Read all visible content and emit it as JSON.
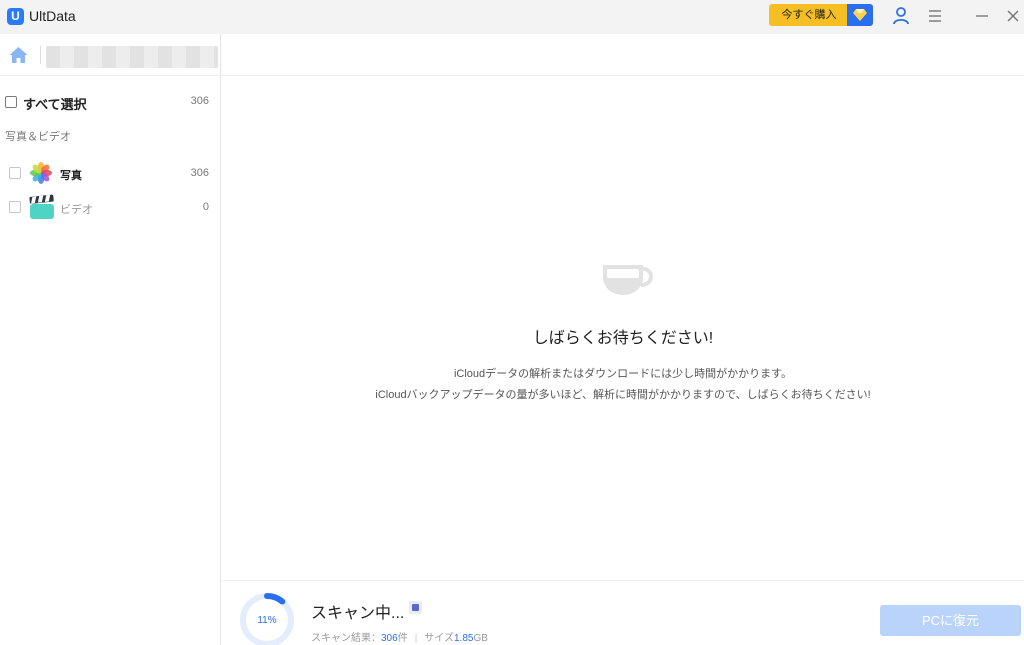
{
  "app": {
    "title": "UltData",
    "logo_letter": "U"
  },
  "titlebar": {
    "buy_label": "今すぐ購入",
    "buy_color": "#f5bf24",
    "accent_color": "#2a6ff0",
    "icons": [
      "user-icon",
      "menu-icon",
      "minimize-icon",
      "close-icon",
      "diamond-icon"
    ]
  },
  "sidebar": {
    "select_all": {
      "label": "すべて選択",
      "count": "306"
    },
    "group_label": "写真＆ビデオ",
    "items": [
      {
        "label": "写真",
        "count": "306",
        "icon": "photos-app-icon"
      },
      {
        "label": "ビデオ",
        "count": "0",
        "icon": "video-clapper-icon"
      }
    ]
  },
  "main": {
    "wait_title": "しばらくお待ちください!",
    "wait_line1": "iCloudデータの解析またはダウンロードには少し時間がかかります。",
    "wait_line2": "iCloudバックアップデータの量が多いほど、解析に時間がかかりますので、しばらくお待ちください!"
  },
  "scan": {
    "progress_label": "11%",
    "progress_value": 0.11,
    "title": "スキャン中...",
    "result_prefix": "スキャン結果：",
    "result_count": "306",
    "result_unit": "件",
    "size_prefix": "サイズ",
    "size_value": "1.85",
    "size_unit": "GB",
    "restore_label": "PCに復元"
  }
}
